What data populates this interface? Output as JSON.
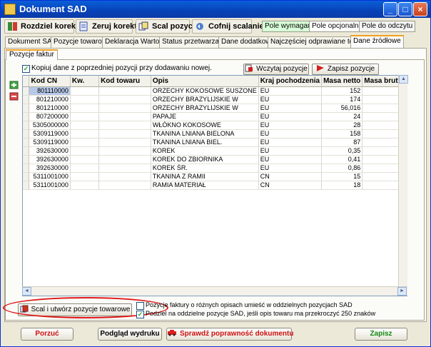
{
  "window": {
    "title": "Dokument SAD",
    "minimize": "_",
    "maximize": "□",
    "close": "×"
  },
  "toolbar": [
    {
      "label": "Rozdziel korektę",
      "icon": "split-icon"
    },
    {
      "label": "Zeruj korekty",
      "icon": "reset-icon"
    },
    {
      "label": "Scal pozycje",
      "icon": "merge-icon"
    },
    {
      "label": "Cofnij scalanie",
      "icon": "undo-merge-icon"
    }
  ],
  "legend": {
    "required": "Pole wymagane",
    "optional": "Pole opcjonalne",
    "readonly": "Pole do odczytu"
  },
  "tabs": [
    "Dokument SAD",
    "Pozycje towarowe",
    "Deklaracja Wartości",
    "Status przetwarzania",
    "Dane dodatkowe",
    "Najczęściej odprawiane towary",
    "Dane źródłowe"
  ],
  "active_tab": "Dane źródłowe",
  "subtab": "Pozycje faktur",
  "copy_checkbox": {
    "checked": true,
    "label": "Kopiuj dane z poprzedniej pozycji przy dodawaniu nowej."
  },
  "buttons": {
    "load": "Wczytaj pozycje",
    "save_items": "Zapisz pozycje",
    "merge_create": "Scal i utwórz pozycje towarowe",
    "cancel": "Porzuć",
    "preview": "Podgląd wydruku",
    "validate": "Sprawdź poprawność dokumentu",
    "save": "Zapisz"
  },
  "grid": {
    "columns": [
      "Kod CN",
      "Kw.",
      "Kod towaru",
      "Opis",
      "Kraj pochodzenia",
      "Masa netto",
      "Masa brutto"
    ],
    "rows": [
      [
        "801110000",
        "",
        "",
        "ORZECHY KOKOSOWE SUSZONE",
        "EU",
        "152",
        ""
      ],
      [
        "801210000",
        "",
        "",
        "ORZECHY BRAZYLIJSKIE W",
        "EU",
        "174",
        ""
      ],
      [
        "801210000",
        "",
        "",
        "ORZECHY BRAZYLIJSKIE W",
        "EU",
        "56,016",
        ""
      ],
      [
        "807200000",
        "",
        "",
        "PAPAJE",
        "EU",
        "24",
        ""
      ],
      [
        "5305000000",
        "",
        "",
        "WŁÓKNO KOKOSOWE",
        "EU",
        "28",
        ""
      ],
      [
        "5309119000",
        "",
        "",
        "TKANINA LNIANA BIELONA",
        "EU",
        "158",
        ""
      ],
      [
        "5309119000",
        "",
        "",
        "TKANINA LNIANA BIEL.",
        "EU",
        "87",
        ""
      ],
      [
        "392630000",
        "",
        "",
        "KOREK",
        "EU",
        "0,35",
        ""
      ],
      [
        "392630000",
        "",
        "",
        "KOREK DO ZBIORNIKA",
        "EU",
        "0,41",
        ""
      ],
      [
        "392630000",
        "",
        "",
        "KOREK ŚR.",
        "EU",
        "0,86",
        ""
      ],
      [
        "5311001000",
        "",
        "",
        "TKANINA Z RAMII",
        "CN",
        "15",
        ""
      ],
      [
        "5311001000",
        "",
        "",
        "RAMIA MATERIAŁ",
        "CN",
        "18",
        ""
      ]
    ]
  },
  "options": [
    {
      "checked": false,
      "label": "Pozycje faktury o różnych opisach umieść w oddzielnych pozycjach SAD"
    },
    {
      "checked": true,
      "label": "Podziel na oddzielne pozycje SAD, jeśli opis towaru ma przekroczyć 250 znaków"
    }
  ]
}
